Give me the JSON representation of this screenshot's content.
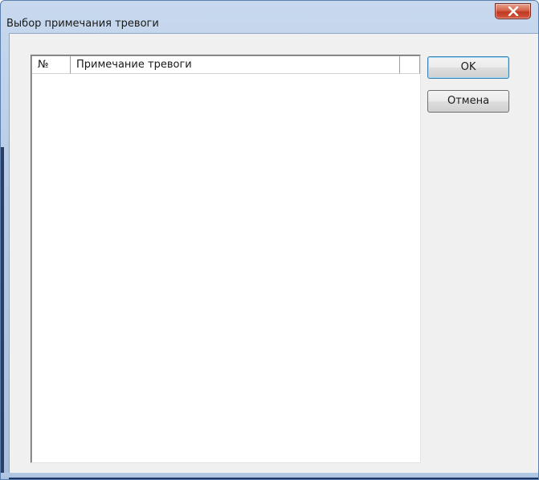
{
  "window": {
    "title": "Выбор примечания тревоги"
  },
  "titlebar": {
    "close_icon": "close-x-icon"
  },
  "list": {
    "columns": [
      "№",
      "Примечание тревоги",
      ""
    ],
    "rows": []
  },
  "buttons": {
    "ok_label": "OK",
    "cancel_label": "Отмена"
  },
  "colors": {
    "titlebar": "#b6cbe6",
    "client_bg": "#f0f0f0",
    "close_button": "#c7432b",
    "list_bg": "#ffffff"
  }
}
